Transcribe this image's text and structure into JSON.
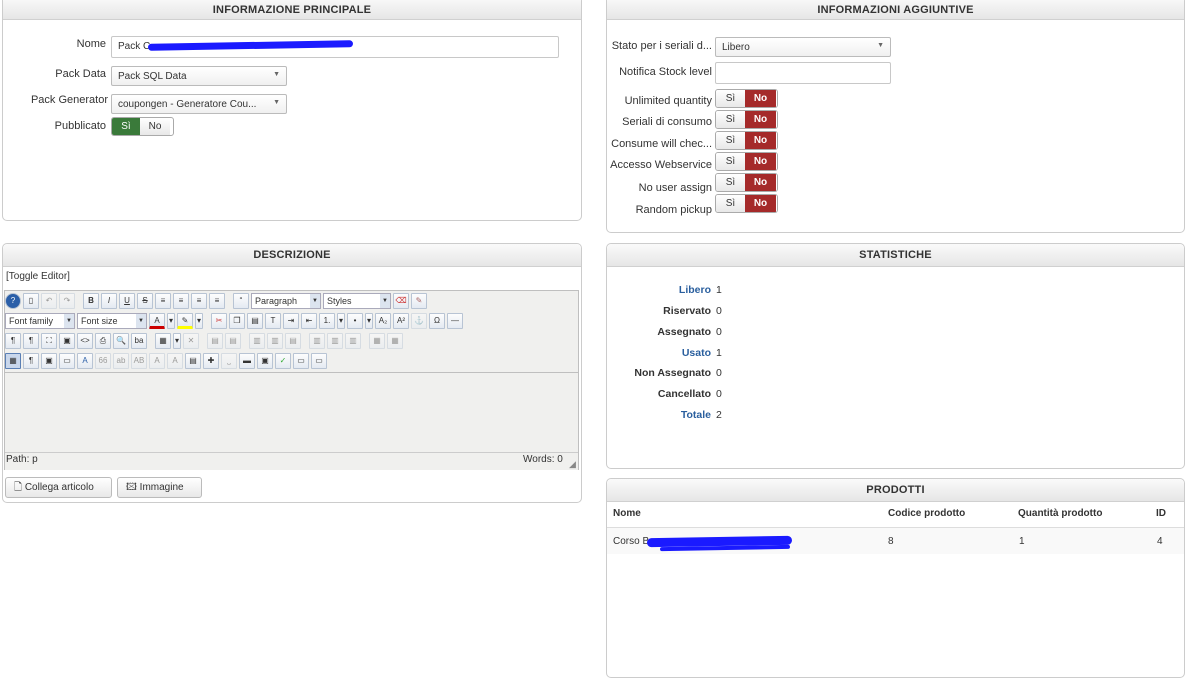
{
  "main_info": {
    "title": "INFORMAZIONE PRINCIPALE",
    "name_label": "Nome",
    "name_value": "Pack C",
    "pack_data_label": "Pack Data",
    "pack_data_value": "Pack SQL Data",
    "pack_generator_label": "Pack Generator",
    "pack_generator_value": "coupongen - Generatore Cou...",
    "published_label": "Pubblicato",
    "yes": "Sì",
    "no": "No"
  },
  "extra_info": {
    "title": "INFORMAZIONI AGGIUNTIVE",
    "serial_state_label": "Stato per i seriali d...",
    "serial_state_value": "Libero",
    "notify_stock_label": "Notifica Stock level",
    "notify_stock_value": "",
    "toggles": [
      {
        "label": "Unlimited quantity"
      },
      {
        "label": "Seriali di consumo"
      },
      {
        "label": "Consume will chec..."
      },
      {
        "label": "Accesso Webservice"
      },
      {
        "label": "No user assign"
      },
      {
        "label": "Random pickup"
      }
    ],
    "yes": "Sì",
    "no": "No"
  },
  "description": {
    "title": "DESCRIZIONE",
    "toggle_editor": "[Toggle Editor]",
    "paragraph_select": "Paragraph",
    "styles_select": "Styles",
    "font_family_select": "Font family",
    "font_size_select": "Font size",
    "path_label": "Path: p",
    "words_label": "Words: 0",
    "link_article_button": "Collega articolo",
    "image_button": "Immagine"
  },
  "stats": {
    "title": "STATISTICHE",
    "rows": [
      {
        "label": "Libero",
        "value": "1"
      },
      {
        "label": "Riservato",
        "value": "0"
      },
      {
        "label": "Assegnato",
        "value": "0"
      },
      {
        "label": "Usato",
        "value": "1"
      },
      {
        "label": "Non Assegnato",
        "value": "0"
      },
      {
        "label": "Cancellato",
        "value": "0"
      },
      {
        "label": "Totale",
        "value": "2"
      }
    ]
  },
  "products": {
    "title": "PRODOTTI",
    "columns": [
      "Nome",
      "Codice prodotto",
      "Quantità prodotto",
      "ID"
    ],
    "rows": [
      {
        "name": "Corso B",
        "code": "8",
        "qty": "1",
        "id": "4"
      }
    ]
  },
  "colors": {
    "no_active": "#a52a2a",
    "yes_active": "#3a7a3a",
    "link": "#2a5f9e"
  }
}
